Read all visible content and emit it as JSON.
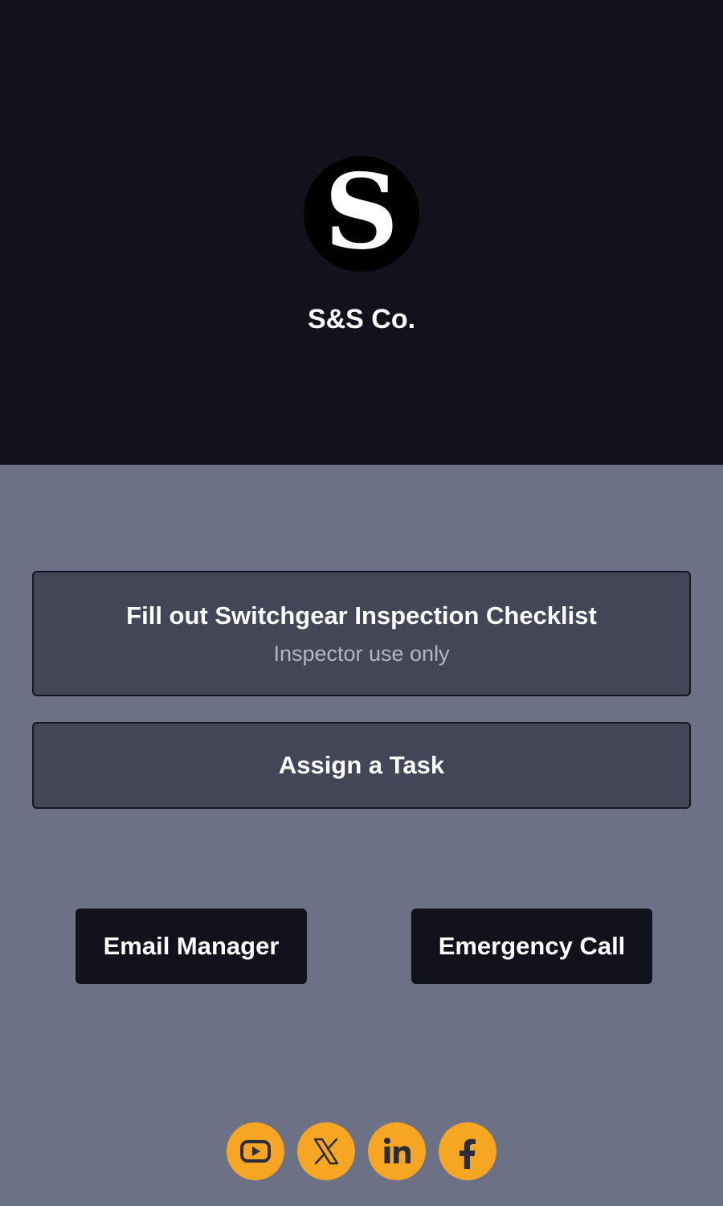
{
  "brand": {
    "logo_letter": "S",
    "name": "S&S Co."
  },
  "actions": {
    "checklist": {
      "title": "Fill out Switchgear Inspection Checklist",
      "subtitle": "Inspector use only"
    },
    "assign_task": {
      "title": "Assign a Task"
    },
    "email_manager": {
      "label": "Email Manager"
    },
    "emergency_call": {
      "label": "Emergency Call"
    }
  },
  "socials": [
    {
      "icon": "youtube-icon"
    },
    {
      "icon": "x-icon"
    },
    {
      "icon": "linkedin-icon"
    },
    {
      "icon": "facebook-icon"
    }
  ],
  "colors": {
    "header_bg": "#11121b",
    "page_bg": "#6c7185",
    "button_bg": "#424657",
    "accent": "#f6a623"
  }
}
